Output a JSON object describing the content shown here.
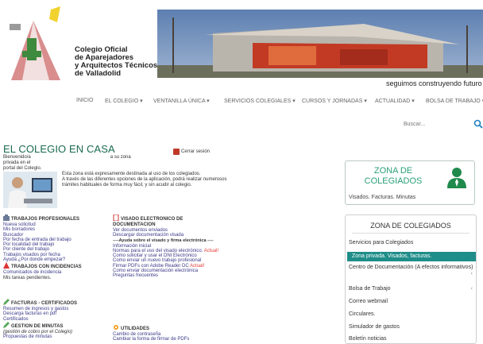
{
  "header": {
    "org_name_lines": [
      "Colegio Oficial",
      "de Aparejadores",
      "y Arquitectos Técnicos",
      "de Valladolid"
    ],
    "slogan": "seguimos construyendo futuro"
  },
  "nav": [
    {
      "label": "INICIO"
    },
    {
      "label": "EL COLEGIO ▾"
    },
    {
      "label": "VENTANILLA ÚNICA ▾"
    },
    {
      "label": "SERVICIOS COLEGIALES ▾"
    },
    {
      "label": "CURSOS Y JORNADAS ▾"
    },
    {
      "label": "ACTUALIDAD ▾"
    },
    {
      "label": "BOLSA DE TRABAJO ▾"
    }
  ],
  "search": {
    "placeholder": "Buscar..."
  },
  "main": {
    "title": "EL COLEGIO EN CASA",
    "welcome_a": "Bienvenido/a",
    "welcome_b": "a su zona privada en el",
    "welcome_c": "portal del Colegio.",
    "logout": "Cerrar sesión",
    "intro_lines": [
      "Esta zona está expresamente destinada al uso de los colegiados.",
      "A través de las diferentes opciones de la aplicación, podrá realizar numerosos",
      "trámites habituales de forma muy fácil, y sin acudir al colegio."
    ]
  },
  "sections": {
    "trabajos": {
      "title": "TRABAJOS PROFESIONALES",
      "links": [
        "Nueva solicitud",
        "Mis borradores",
        "Buscador",
        "Por fecha de entrada del trabajo",
        "Por localidad del trabajo",
        "Por cliente del trabajo",
        "Trabajos visados por fecha",
        "Ayuda ¿Por donde empezar?"
      ]
    },
    "incidencias": {
      "title": "TRABAJOS CON INCIDENCIAS",
      "links": [
        "Comunicados de incidencia"
      ],
      "note": "Mis tareas pendientes."
    },
    "facturas": {
      "title": "FACTURAS - CERTIFICADOS",
      "links": [
        "Resumen de ingresos y gastos",
        "Descarga facturas en pdf",
        "Certificados"
      ]
    },
    "minutas": {
      "title": "GESTION DE MINUTAS",
      "subtitle": "(gestión de cobro por el Colegio)",
      "links": [
        "Propuestas de minutas"
      ]
    },
    "visado": {
      "title_a": "VISADO ELECTRONICO DE",
      "title_b": "DOCUMENTACION",
      "links_a": [
        "Ver documentos enviados",
        "Descargar documentación visada"
      ],
      "subhead": "----Ayuda sobre el visado y firma electrónica ----",
      "links_b": [
        "Información inicial",
        "Normas para el uso del visado electrónico.",
        "Como solicitar y usar el DNI Electrónico",
        "Como enviar un nuevo trabajo profesional",
        "Firmar PDFs con Adobe Reader DC",
        "Como enviar documentación electrónica",
        "Preguntas frecuentes"
      ],
      "actual": "Actual!"
    },
    "utilidades": {
      "title": "UTILIDADES",
      "links": [
        "Cambio de contraseña",
        "Cambiar la forma de firmar de PDFs"
      ]
    }
  },
  "sidebar": {
    "zona_box_title": "ZONA DE COLEGIADOS",
    "zona_box_sub": "Visados. Facturas. Minutas",
    "menu_title": "ZONA DE COLEGIADOS",
    "items": [
      {
        "label": "Servicios para Colegiados",
        "active": false,
        "chevron": false
      },
      {
        "label": "Zona privada. Visados, facturas.",
        "active": true,
        "chevron": false
      },
      {
        "label": "Centro de Documentación (A efectos informativos)",
        "active": false,
        "chevron": true
      },
      {
        "label": "Bolsa de Trabajo",
        "active": false,
        "chevron": true
      },
      {
        "label": "Correo webmail",
        "active": false,
        "chevron": false
      },
      {
        "label": "Circulares.",
        "active": false,
        "chevron": false
      },
      {
        "label": "Simulador de gastos",
        "active": false,
        "chevron": false
      },
      {
        "label": "Boletín noticias",
        "active": false,
        "chevron": false
      }
    ]
  },
  "colors": {
    "accent": "#1f8d89",
    "title_green": "#1a6b4e",
    "link_blue": "#3a3a8a",
    "alert_red": "#e53935"
  }
}
